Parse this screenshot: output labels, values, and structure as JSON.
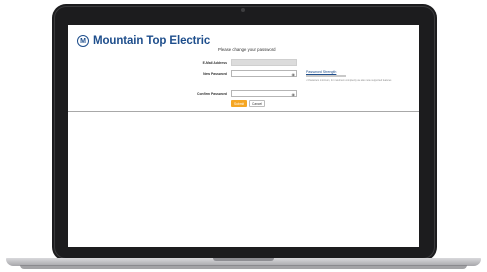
{
  "header": {
    "logo_text": "Mountain Top Electric",
    "logo_glyph": "M"
  },
  "form": {
    "prompt": "Please change your password",
    "email_label": "E-Mail Address",
    "email_value": "",
    "new_password_label": "New Password",
    "confirm_password_label": "Confirm Password",
    "strength_link": "Password Strength",
    "hint": "• Characters minimum, for maximum complexity we also note supported features",
    "submit_label": "Submit",
    "cancel_label": "Cancel"
  },
  "colors": {
    "brand": "#1e4e8c",
    "accent": "#f5a623"
  },
  "icons": {
    "eye": "eye-icon"
  }
}
